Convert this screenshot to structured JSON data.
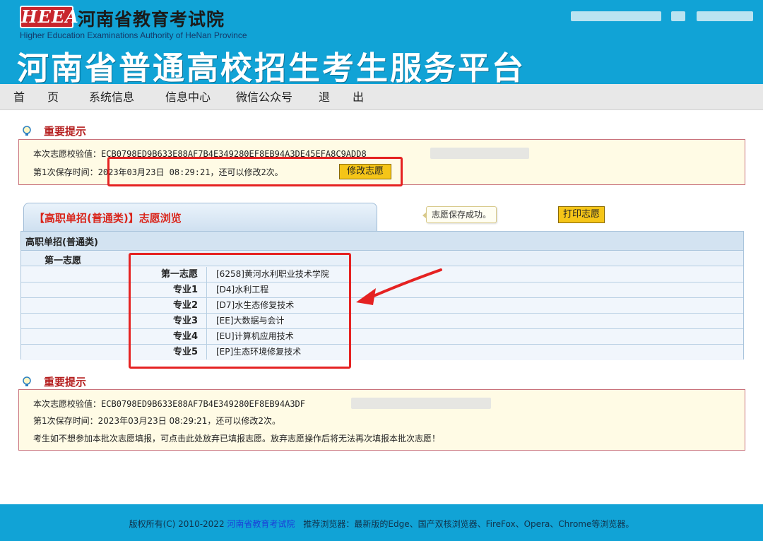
{
  "header": {
    "logo_text": "HEEA",
    "org_name_cn": "河南省教育考试院",
    "org_name_en": "Higher Education Examinations Authority of HeNan Province",
    "platform_title": "河南省普通高校招生考生服务平台"
  },
  "nav": {
    "items": [
      "首　　页",
      "系统信息",
      "信息中心",
      "微信公众号",
      "退　　出"
    ]
  },
  "notice_top": {
    "title": "重要提示",
    "checksum_label": "本次志愿校验值：",
    "checksum_value": "ECB0798ED9B633E88AF7B4E349280EF8EB94A3DE45EFA8C9ADD8",
    "save_label": "第1次保存时间：",
    "save_time": "2023年03月23日 08:29:21，还可以修改2次。",
    "modify_button": "修改志愿"
  },
  "browse": {
    "tab_title": "【高职单招(普通类)】志愿浏览",
    "toast": "志愿保存成功。",
    "print_button": "打印志愿",
    "table_header": "高职单招(普通类)",
    "sub_header": "第一志愿",
    "rows": [
      {
        "label": "第一志愿",
        "value": "[6258]黄河水利职业技术学院"
      },
      {
        "label": "专业1",
        "value": "[D4]水利工程"
      },
      {
        "label": "专业2",
        "value": "[D7]水生态修复技术"
      },
      {
        "label": "专业3",
        "value": "[EE]大数据与会计"
      },
      {
        "label": "专业4",
        "value": "[EU]计算机应用技术"
      },
      {
        "label": "专业5",
        "value": "[EP]生态环境修复技术"
      }
    ]
  },
  "notice_bottom": {
    "title": "重要提示",
    "checksum_label": "本次志愿校验值：",
    "checksum_value": "ECB0798ED9B633E88AF7B4E349280EF8EB94A3DF",
    "save_line": "第1次保存时间：2023年03月23日 08:29:21，还可以修改2次。",
    "abandon_line": "考生如不想参加本批次志愿填报，可点击此处放弃已填报志愿。放弃志愿操作后将无法再次填报本批次志愿！"
  },
  "footer": {
    "copyright": "版权所有(C) 2010-2022 ",
    "org_link": "河南省教育考试院",
    "browsers": "　推荐浏览器：最新版的Edge、国产双核浏览器、FireFox、Opera、Chrome等浏览器。"
  },
  "colors": {
    "header_blue": "#11a3d6",
    "title_red": "#b51e1e",
    "button_yellow": "#f5c518",
    "annotation_red": "#e52222"
  }
}
